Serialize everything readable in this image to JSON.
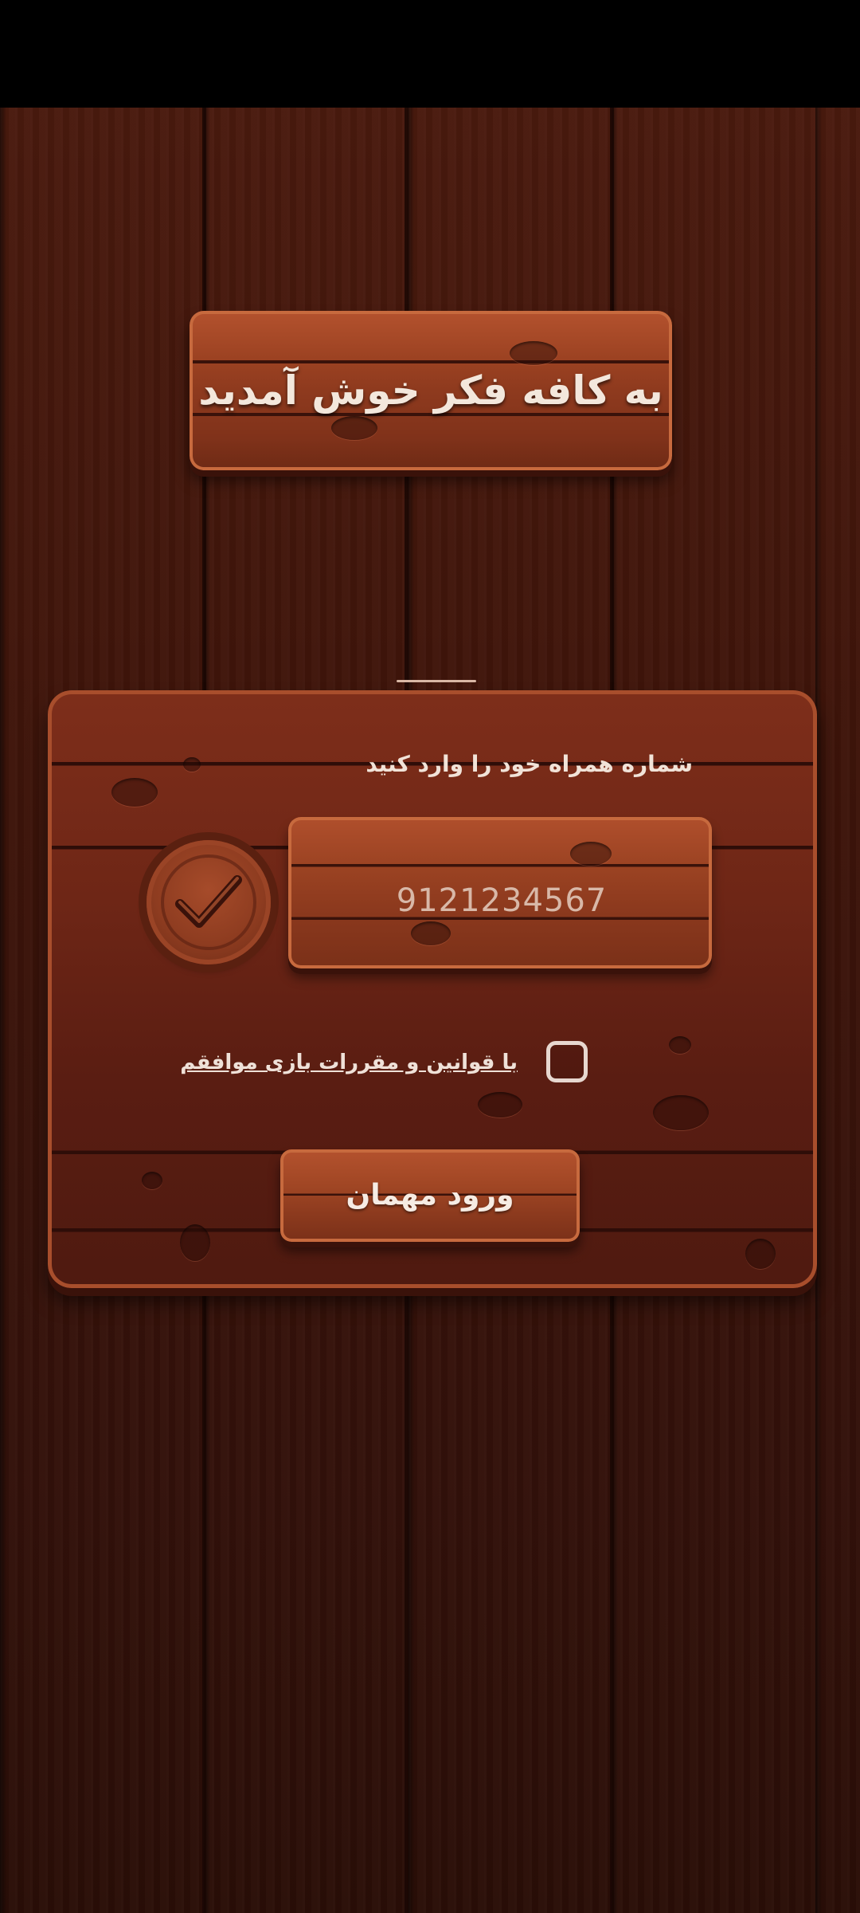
{
  "title": "به کافه فکر خوش آمدید",
  "phone_prompt": "شماره همراه خود را وارد کنید",
  "phone_input": {
    "value": "9121234567"
  },
  "terms": {
    "label": "با قوانین و مقررات بازی موافقم",
    "checked": false
  },
  "guest_button": {
    "label": "ورود مهمان"
  },
  "icons": {
    "confirm": "check-badge-icon",
    "checkbox": "checkbox-empty"
  },
  "colors": {
    "wood_dark": "#3d140a",
    "wood_sign": "#9c4222",
    "text_light": "#f3e7dc"
  }
}
